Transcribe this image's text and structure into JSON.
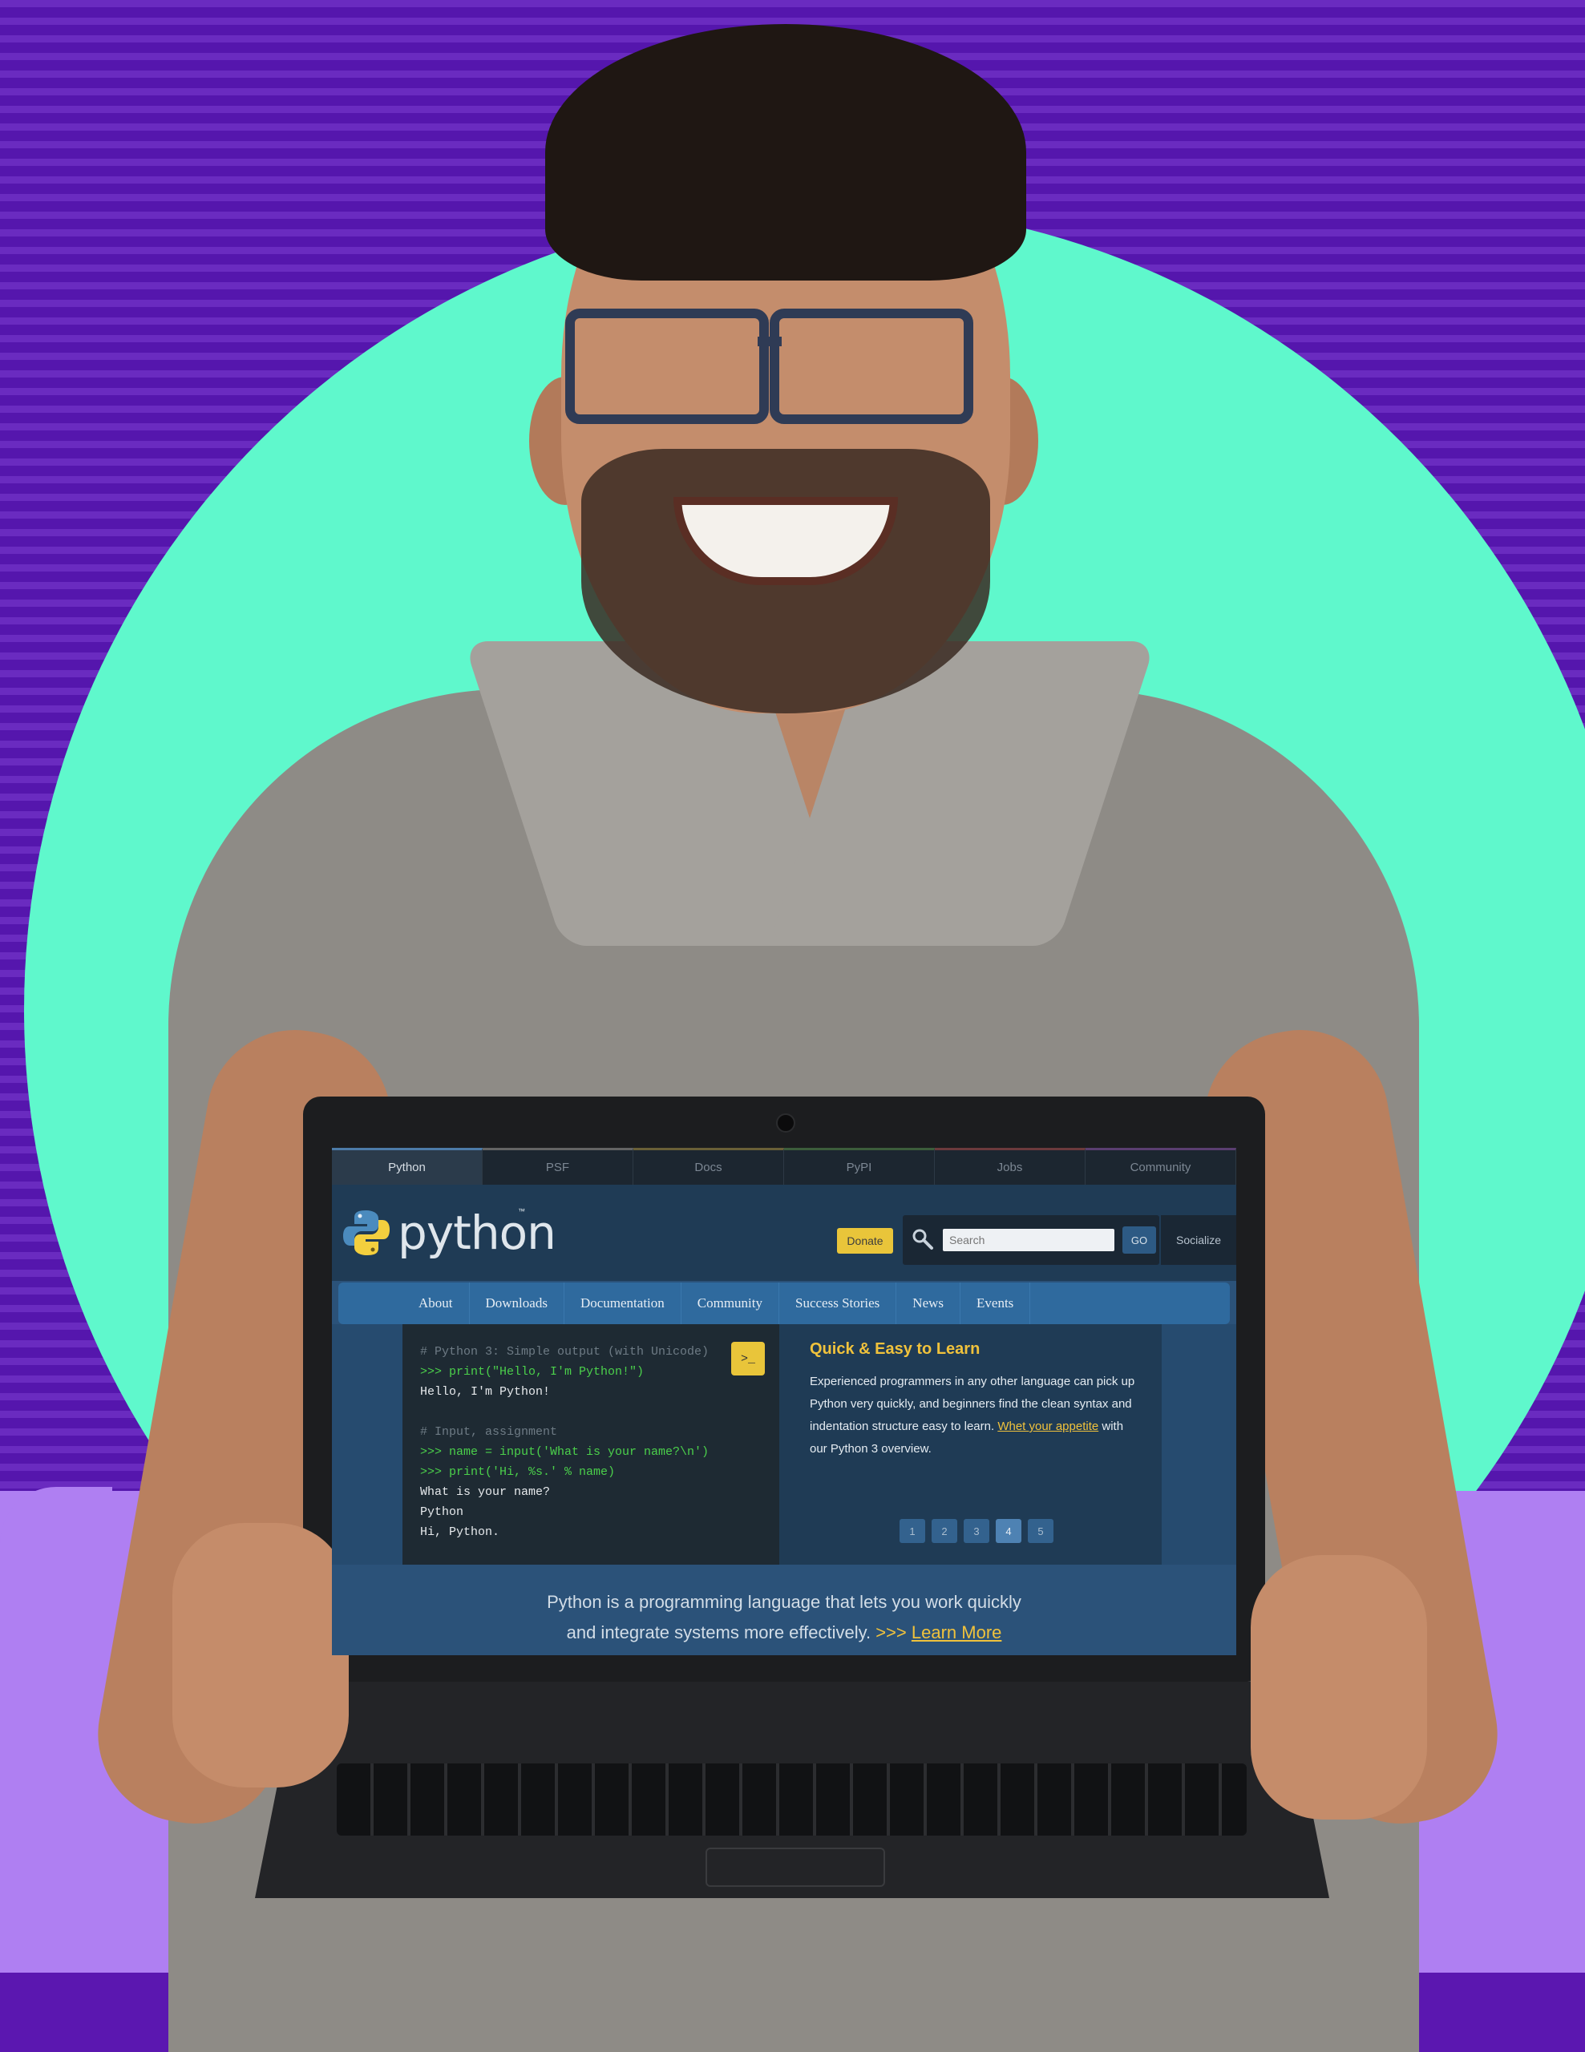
{
  "top_nav": {
    "items": [
      "Python",
      "PSF",
      "Docs",
      "PyPI",
      "Jobs",
      "Community"
    ],
    "active": "Python"
  },
  "header": {
    "logo_text": "python",
    "logo_tm": "™",
    "donate_label": "Donate",
    "search_placeholder": "Search",
    "go_label": "GO",
    "socialize_label": "Socialize"
  },
  "main_nav": {
    "items": [
      "About",
      "Downloads",
      "Documentation",
      "Community",
      "Success Stories",
      "News",
      "Events"
    ]
  },
  "code_sample": {
    "lines": [
      {
        "kind": "comment",
        "text": "# Python 3: Simple output (with Unicode)"
      },
      {
        "kind": "prompt",
        "text": ">>> print(\"Hello, I'm Python!\")"
      },
      {
        "kind": "output",
        "text": "Hello, I'm Python!"
      },
      {
        "kind": "blank",
        "text": ""
      },
      {
        "kind": "comment",
        "text": "# Input, assignment"
      },
      {
        "kind": "prompt",
        "text": ">>> name = input('What is your name?\\n')"
      },
      {
        "kind": "prompt",
        "text": ">>> print('Hi, %s.' % name)"
      },
      {
        "kind": "output",
        "text": "What is your name?"
      },
      {
        "kind": "output",
        "text": "Python"
      },
      {
        "kind": "output",
        "text": "Hi, Python."
      }
    ],
    "shell_button_label": ">_"
  },
  "info": {
    "title": "Quick & Easy to Learn",
    "body": "Experienced programmers in any other language can pick up Python very quickly, and beginners find the clean syntax and indentation structure easy to learn.",
    "link_text": "Whet your appetite",
    "body_tail": "with our Python 3 overview."
  },
  "pager": {
    "pages": [
      "1",
      "2",
      "3",
      "4",
      "5"
    ],
    "active": "4"
  },
  "tagline": {
    "line1": "Python is a programming language that lets you work quickly",
    "line2": "and integrate systems more effectively.",
    "arrows": ">>>",
    "learn_more": "Learn More"
  },
  "colors": {
    "page_bg_purple": "#5b17b0",
    "circle_mint": "#5ff8cc",
    "lilac": "#af7ff2",
    "python_yellow": "#e9c53a",
    "python_blue": "#2f6a9e"
  }
}
